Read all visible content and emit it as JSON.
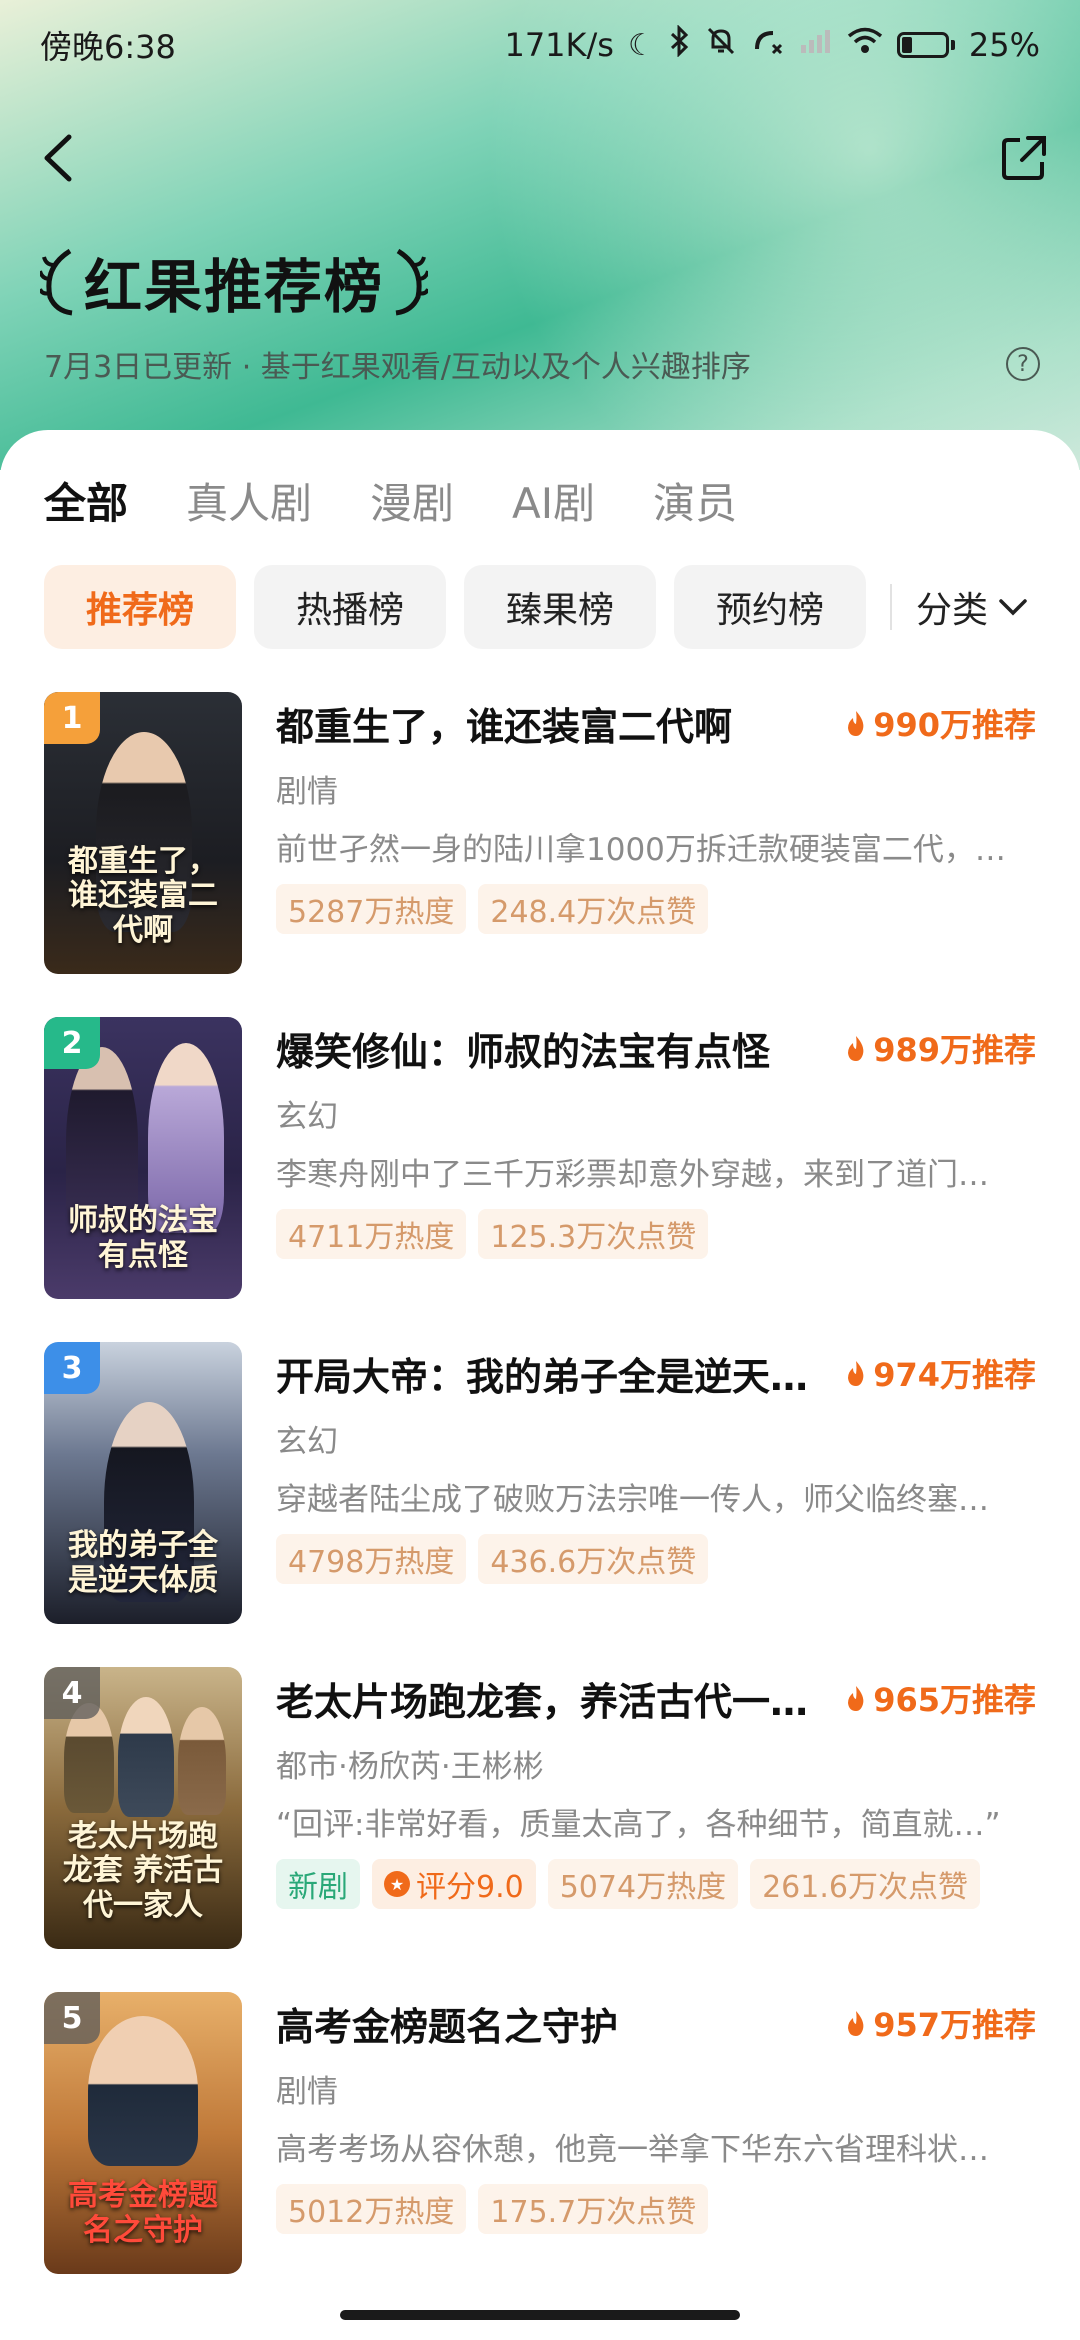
{
  "status_bar": {
    "time": "傍晚6:38",
    "net_speed": "171K/s",
    "battery": "25%",
    "battery_level": 0.25
  },
  "header": {
    "title": "红果推荐榜",
    "subtitle": "7月3日已更新 · 基于红果观看/互动以及个人兴趣排序",
    "help_symbol": "?"
  },
  "tabs": [
    "全部",
    "真人剧",
    "漫剧",
    "AI剧",
    "演员"
  ],
  "chips": [
    "推荐榜",
    "热播榜",
    "臻果榜",
    "预约榜"
  ],
  "sort_label": "分类",
  "items": [
    {
      "rank": "1",
      "rank_color": "#f5a03a",
      "title": "都重生了，谁还装富二代啊",
      "recommend": "990万推荐",
      "genre": "剧情",
      "desc": "前世孑然一身的陆川拿1000万拆迁款硬装富二代，…",
      "tags": [
        "5287万热度",
        "248.4万次点赞"
      ],
      "poster_title": "都重生了，谁还装富二代啊"
    },
    {
      "rank": "2",
      "rank_color": "#26b98a",
      "title": "爆笑修仙：师叔的法宝有点怪",
      "recommend": "989万推荐",
      "genre": "玄幻",
      "desc": "李寒舟刚中了三千万彩票却意外穿越，来到了道门…",
      "tags": [
        "4711万热度",
        "125.3万次点赞"
      ],
      "poster_title": "师叔的法宝有点怪"
    },
    {
      "rank": "3",
      "rank_color": "#3d8fe8",
      "title": "开局大帝：我的弟子全是逆天…",
      "recommend": "974万推荐",
      "genre": "玄幻",
      "desc": "穿越者陆尘成了破败万法宗唯一传人，师父临终塞…",
      "tags": [
        "4798万热度",
        "436.6万次点赞"
      ],
      "poster_title": "我的弟子全是逆天体质"
    },
    {
      "rank": "4",
      "rank_color": "#8a8a8a",
      "title": "老太片场跑龙套，养活古代一…",
      "recommend": "965万推荐",
      "genre": "都市·杨欣芮·王彬彬",
      "desc": "“回评:非常好看，质量太高了，各种细节，简直就…”",
      "new_tag": "新剧",
      "score_tag": "评分9.0",
      "tags": [
        "5074万热度",
        "261.6万次点赞"
      ],
      "poster_title": "老太片场跑龙套 养活古代一家人"
    },
    {
      "rank": "5",
      "rank_color": "#8a8a8a",
      "title": "高考金榜题名之守护",
      "recommend": "957万推荐",
      "genre": "剧情",
      "desc": "高考考场从容休憩，他竟一举拿下华东六省理科状…",
      "tags": [
        "5012万热度",
        "175.7万次点赞"
      ],
      "poster_title": "高考金榜题名之守护"
    }
  ]
}
